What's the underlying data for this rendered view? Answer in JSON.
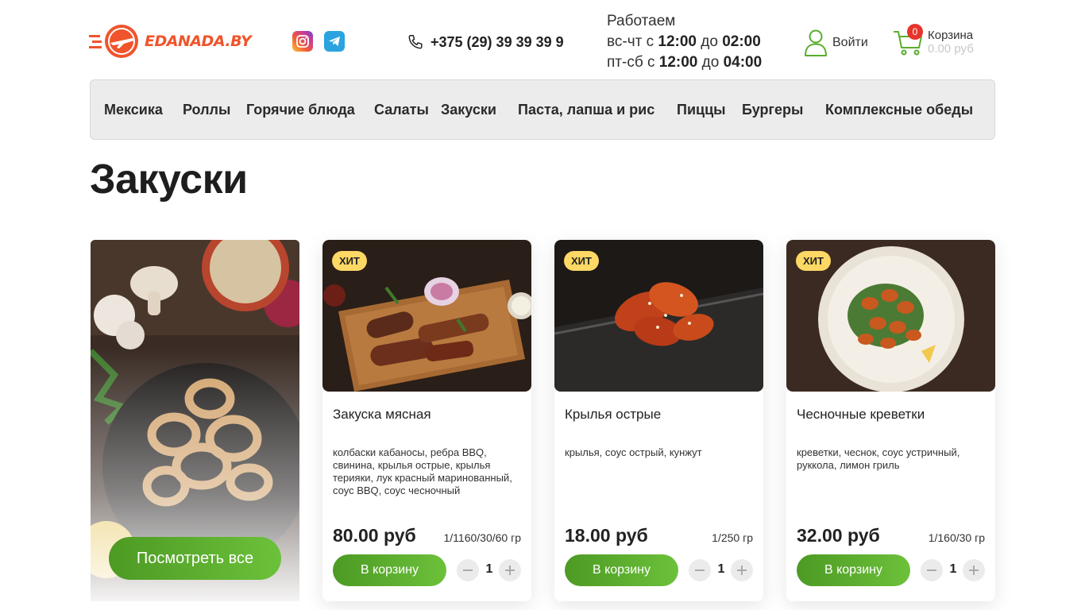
{
  "header": {
    "logo_text": "EDANADA.BY",
    "phone": "+375 (29) 39 39 39 9",
    "hours": {
      "title": "Работаем",
      "line1_prefix": "вс-чт с",
      "line1_from": "12:00",
      "line1_mid": "до",
      "line1_to": "02:00",
      "line2_prefix": "пт-сб с",
      "line2_from": "12:00",
      "line2_mid": "до",
      "line2_to": "04:00"
    },
    "login_label": "Войти",
    "cart": {
      "count": "0",
      "label": "Корзина",
      "total": "0.00 руб"
    }
  },
  "nav": {
    "items": [
      {
        "label": "Мексика"
      },
      {
        "label": "Роллы"
      },
      {
        "label": "Горячие блюда"
      },
      {
        "label": "Салаты"
      },
      {
        "label": "Закуски"
      },
      {
        "label": "Паста, лапша и рис"
      },
      {
        "label": "Пиццы"
      },
      {
        "label": "Бургеры"
      },
      {
        "label": "Комплексные обеды"
      }
    ]
  },
  "main": {
    "title": "Закуски",
    "promo": {
      "button_label": "Посмотреть все"
    },
    "products": [
      {
        "badge": "ХИТ",
        "name": "Закуска мясная",
        "description": "колбаски кабаносы, ребра BBQ, свинина, крылья острые, крылья терияки, лук красный маринованный, соус BBQ, соус чесночный",
        "price": "80.00 руб",
        "weight": "1/1160/30/60 гр",
        "button_label": "В корзину",
        "quantity": "1"
      },
      {
        "badge": "ХИТ",
        "name": "Крылья острые",
        "description": "крылья, соус острый, кунжут",
        "price": "18.00 руб",
        "weight": "1/250 гр",
        "button_label": "В корзину",
        "quantity": "1"
      },
      {
        "badge": "ХИТ",
        "name": "Чесночные креветки",
        "description": "креветки, чеснок, соус устричный, руккола, лимон гриль",
        "price": "32.00 руб",
        "weight": "1/160/30 гр",
        "button_label": "В корзину",
        "quantity": "1"
      }
    ]
  },
  "colors": {
    "accent_green": "#5aad2e",
    "logo_orange": "#f0542b",
    "badge_yellow": "#fdd864",
    "cart_badge_red": "#e6352b",
    "nav_bg": "#ececec"
  },
  "icons": [
    "logo-plane-icon",
    "instagram-icon",
    "telegram-icon",
    "phone-icon",
    "user-icon",
    "cart-icon",
    "minus-icon",
    "plus-icon"
  ]
}
